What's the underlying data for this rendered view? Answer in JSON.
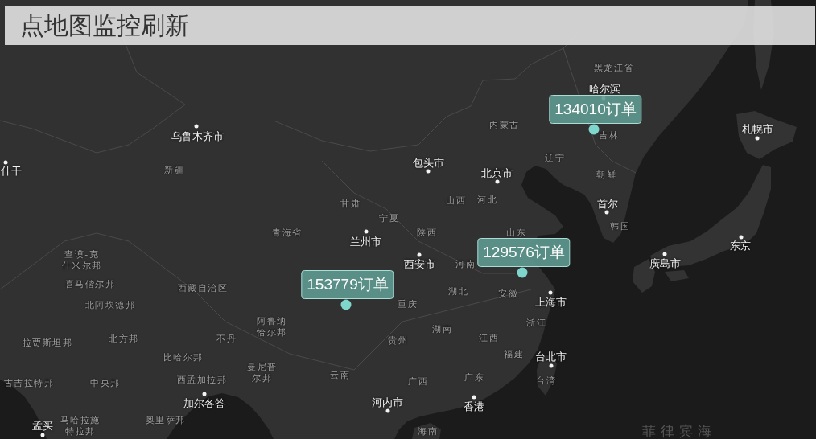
{
  "title": "点地图监控刷新",
  "map_labels": [
    {
      "text": "黑龙江省",
      "kind": "region"
    },
    {
      "text": "哈尔滨",
      "kind": "city"
    },
    {
      "text": "乌鲁木齐市",
      "kind": "city"
    },
    {
      "text": "内蒙古",
      "kind": "region"
    },
    {
      "text": "吉林",
      "kind": "region"
    },
    {
      "text": "札幌市",
      "kind": "city"
    },
    {
      "text": "什干",
      "kind": "city"
    },
    {
      "text": "新疆",
      "kind": "region"
    },
    {
      "text": "包头市",
      "kind": "city"
    },
    {
      "text": "北京市",
      "kind": "city"
    },
    {
      "text": "辽宁",
      "kind": "region"
    },
    {
      "text": "朝鲜",
      "kind": "region"
    },
    {
      "text": "甘肃",
      "kind": "region"
    },
    {
      "text": "山西",
      "kind": "region"
    },
    {
      "text": "河北",
      "kind": "region"
    },
    {
      "text": "首尔",
      "kind": "city"
    },
    {
      "text": "宁夏",
      "kind": "region"
    },
    {
      "text": "韩国",
      "kind": "region"
    },
    {
      "text": "青海省",
      "kind": "region"
    },
    {
      "text": "兰州市",
      "kind": "city"
    },
    {
      "text": "陕西",
      "kind": "region"
    },
    {
      "text": "山东",
      "kind": "region"
    },
    {
      "text": "东京",
      "kind": "city"
    },
    {
      "text": "查谟-克什米尔邦",
      "kind": "region"
    },
    {
      "text": "西安市",
      "kind": "city"
    },
    {
      "text": "河南",
      "kind": "region"
    },
    {
      "text": "廣島市",
      "kind": "city"
    },
    {
      "text": "喜马偕尔邦",
      "kind": "region"
    },
    {
      "text": "西藏自治区",
      "kind": "region"
    },
    {
      "text": "湖北",
      "kind": "region"
    },
    {
      "text": "安徽",
      "kind": "region"
    },
    {
      "text": "北阿坎德邦",
      "kind": "region"
    },
    {
      "text": "重庆",
      "kind": "region"
    },
    {
      "text": "上海市",
      "kind": "city"
    },
    {
      "text": "阿鲁纳恰尔邦",
      "kind": "region"
    },
    {
      "text": "湖南",
      "kind": "region"
    },
    {
      "text": "浙江",
      "kind": "region"
    },
    {
      "text": "拉贾斯坦邦",
      "kind": "region"
    },
    {
      "text": "北方邦",
      "kind": "region"
    },
    {
      "text": "不丹",
      "kind": "region"
    },
    {
      "text": "贵州",
      "kind": "region"
    },
    {
      "text": "江西",
      "kind": "region"
    },
    {
      "text": "比哈尔邦",
      "kind": "region"
    },
    {
      "text": "福建",
      "kind": "region"
    },
    {
      "text": "台北市",
      "kind": "city"
    },
    {
      "text": "古吉拉特邦",
      "kind": "region"
    },
    {
      "text": "中央邦",
      "kind": "region"
    },
    {
      "text": "西孟加拉邦",
      "kind": "region"
    },
    {
      "text": "曼尼普尔邦",
      "kind": "region"
    },
    {
      "text": "云南",
      "kind": "region"
    },
    {
      "text": "广西",
      "kind": "region"
    },
    {
      "text": "广东",
      "kind": "region"
    },
    {
      "text": "台湾",
      "kind": "region"
    },
    {
      "text": "加尔各答",
      "kind": "city"
    },
    {
      "text": "河内市",
      "kind": "city"
    },
    {
      "text": "香港",
      "kind": "city"
    },
    {
      "text": "孟买",
      "kind": "city"
    },
    {
      "text": "马哈拉施特拉邦",
      "kind": "region"
    },
    {
      "text": "奥里萨邦",
      "kind": "region"
    },
    {
      "text": "海南",
      "kind": "region"
    },
    {
      "text": "菲律宾海",
      "kind": "sea"
    }
  ],
  "markers": [
    {
      "label": "134010订单"
    },
    {
      "label": "129576订单"
    },
    {
      "label": "153779订单"
    }
  ]
}
